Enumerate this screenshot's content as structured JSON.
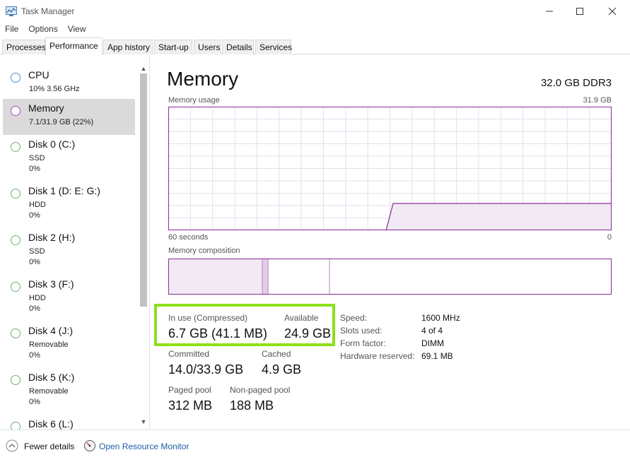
{
  "window": {
    "title": "Task Manager"
  },
  "menu": [
    "File",
    "Options",
    "View"
  ],
  "tabs": [
    "Processes",
    "Performance",
    "App history",
    "Start-up",
    "Users",
    "Details",
    "Services"
  ],
  "active_tab": "Performance",
  "sidebar": {
    "items": [
      {
        "name": "CPU",
        "line1": "10%  3.56 GHz",
        "line2": "",
        "circle": "#4f8fd6"
      },
      {
        "name": "Memory",
        "line1": "7.1/31.9 GB (22%)",
        "line2": "",
        "circle": "#a64ec0"
      },
      {
        "name": "Disk 0 (C:)",
        "line1": "SSD",
        "line2": "0%",
        "circle": "#6bb36b"
      },
      {
        "name": "Disk 1 (D: E: G:)",
        "line1": "HDD",
        "line2": "0%",
        "circle": "#6bb36b"
      },
      {
        "name": "Disk 2 (H:)",
        "line1": "SSD",
        "line2": "0%",
        "circle": "#6bb36b"
      },
      {
        "name": "Disk 3 (F:)",
        "line1": "HDD",
        "line2": "0%",
        "circle": "#6bb36b"
      },
      {
        "name": "Disk 4 (J:)",
        "line1": "Removable",
        "line2": "0%",
        "circle": "#6bb36b"
      },
      {
        "name": "Disk 5 (K:)",
        "line1": "Removable",
        "line2": "0%",
        "circle": "#6bb36b"
      },
      {
        "name": "Disk 6 (L:)",
        "line1": "",
        "line2": "",
        "circle": "#6bb36b"
      }
    ]
  },
  "main": {
    "title": "Memory",
    "spec": "32.0 GB DDR3",
    "usage_label": "Memory usage",
    "usage_max": "31.9 GB",
    "time_left": "60 seconds",
    "time_right": "0",
    "composition_label": "Memory composition",
    "stats": {
      "in_use_label": "In use (Compressed)",
      "in_use_value": "6.7 GB (41.1 MB)",
      "available_label": "Available",
      "available_value": "24.9 GB",
      "committed_label": "Committed",
      "committed_value": "14.0/33.9 GB",
      "cached_label": "Cached",
      "cached_value": "4.9 GB",
      "paged_label": "Paged pool",
      "paged_value": "312 MB",
      "nonpaged_label": "Non-paged pool",
      "nonpaged_value": "188 MB"
    },
    "details": [
      {
        "key": "Speed:",
        "value": "1600 MHz"
      },
      {
        "key": "Slots used:",
        "value": "4 of 4"
      },
      {
        "key": "Form factor:",
        "value": "DIMM"
      },
      {
        "key": "Hardware reserved:",
        "value": "69.1 MB"
      }
    ]
  },
  "footer": {
    "fewer_details": "Fewer details",
    "open_resource_monitor": "Open Resource Monitor"
  },
  "colors": {
    "memory_accent": "#8b2a9c",
    "highlight_box": "#8ce01c",
    "link": "#1a5ea8"
  }
}
